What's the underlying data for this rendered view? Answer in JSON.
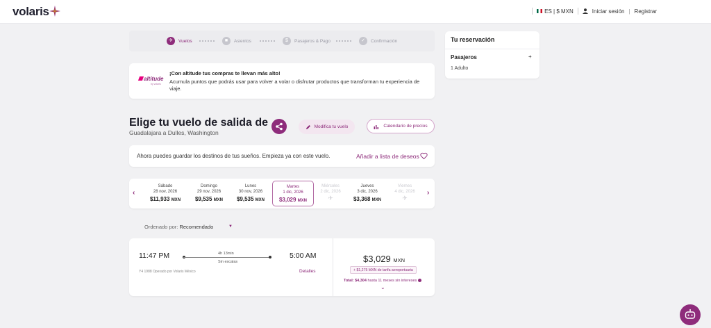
{
  "header": {
    "logo_text": "volaris",
    "lang_currency": "ES | $ MXN",
    "login_link": "Iniciar sesión",
    "register_link": "Registrar"
  },
  "stepper": [
    {
      "label": "Vuelos",
      "active": true,
      "icon": "plane-icon"
    },
    {
      "label": "Asientos",
      "active": false,
      "icon": "seat-icon"
    },
    {
      "label": "Pasajeros & Pago",
      "active": false,
      "icon": "payment-icon"
    },
    {
      "label": "Confirmación",
      "active": false,
      "icon": "check-icon"
    }
  ],
  "promo": {
    "logo": "altitude",
    "logo_sub": "by volaris",
    "title": "¡Con altitude tus compras te llevan más alto!",
    "text": "Acumula puntos que podrás usar para volver a volar o disfrutar productos que transforman tu experiencia de viaje."
  },
  "heading": {
    "title": "Elige tu vuelo de salida de",
    "route": "Guadalajara a Dulles, Washington",
    "modify_label": "Modifica tu vuelo",
    "calendar_label": "Calendario de precios"
  },
  "wishlist": {
    "text": "Ahora puedes guardar los destinos de tus sueños. Empieza ya con este vuelo.",
    "link": "Añadir a lista de deseos"
  },
  "dates": [
    {
      "day": "Sábado",
      "date": "28 nov, 2026",
      "price": "$11,933",
      "cur": "MXN",
      "state": "normal"
    },
    {
      "day": "Domingo",
      "date": "29 nov, 2026",
      "price": "$9,535",
      "cur": "MXN",
      "state": "normal"
    },
    {
      "day": "Lunes",
      "date": "30 nov, 2026",
      "price": "$9,535",
      "cur": "MXN",
      "state": "normal"
    },
    {
      "day": "Martes",
      "date": "1 dic, 2026",
      "price": "$3,029",
      "cur": "MXN",
      "state": "selected"
    },
    {
      "day": "Miércoles",
      "date": "2 dic, 2026",
      "price": "",
      "cur": "",
      "state": "disabled"
    },
    {
      "day": "Jueves",
      "date": "3 dic, 2026",
      "price": "$3,368",
      "cur": "MXN",
      "state": "normal"
    },
    {
      "day": "Viernes",
      "date": "4 dic, 2026",
      "price": "",
      "cur": "",
      "state": "disabled"
    }
  ],
  "sort": {
    "label": "Ordenado por:",
    "value": "Recomendado"
  },
  "flight": {
    "departure": "11:47 PM",
    "arrival": "5:00 AM",
    "duration": "4h 13min",
    "stops": "Sin escalas",
    "operated": "Y4 1988 Operado por Volaris México",
    "details_link": "Detalles",
    "price": "$3,029",
    "currency": "MXN",
    "tax_note": "+ $1,275 MXN de tarifa aeroportuaria",
    "total_label": "Total:",
    "total_value": "$4,304",
    "installments": "hasta 11 meses sin intereses"
  },
  "reservation": {
    "title": "Tu reservación",
    "pax_label": "Pasajeros",
    "pax_count": "1 Adulto"
  },
  "colors": {
    "brand": "#8e2c7b",
    "background": "#f1f1f3"
  }
}
